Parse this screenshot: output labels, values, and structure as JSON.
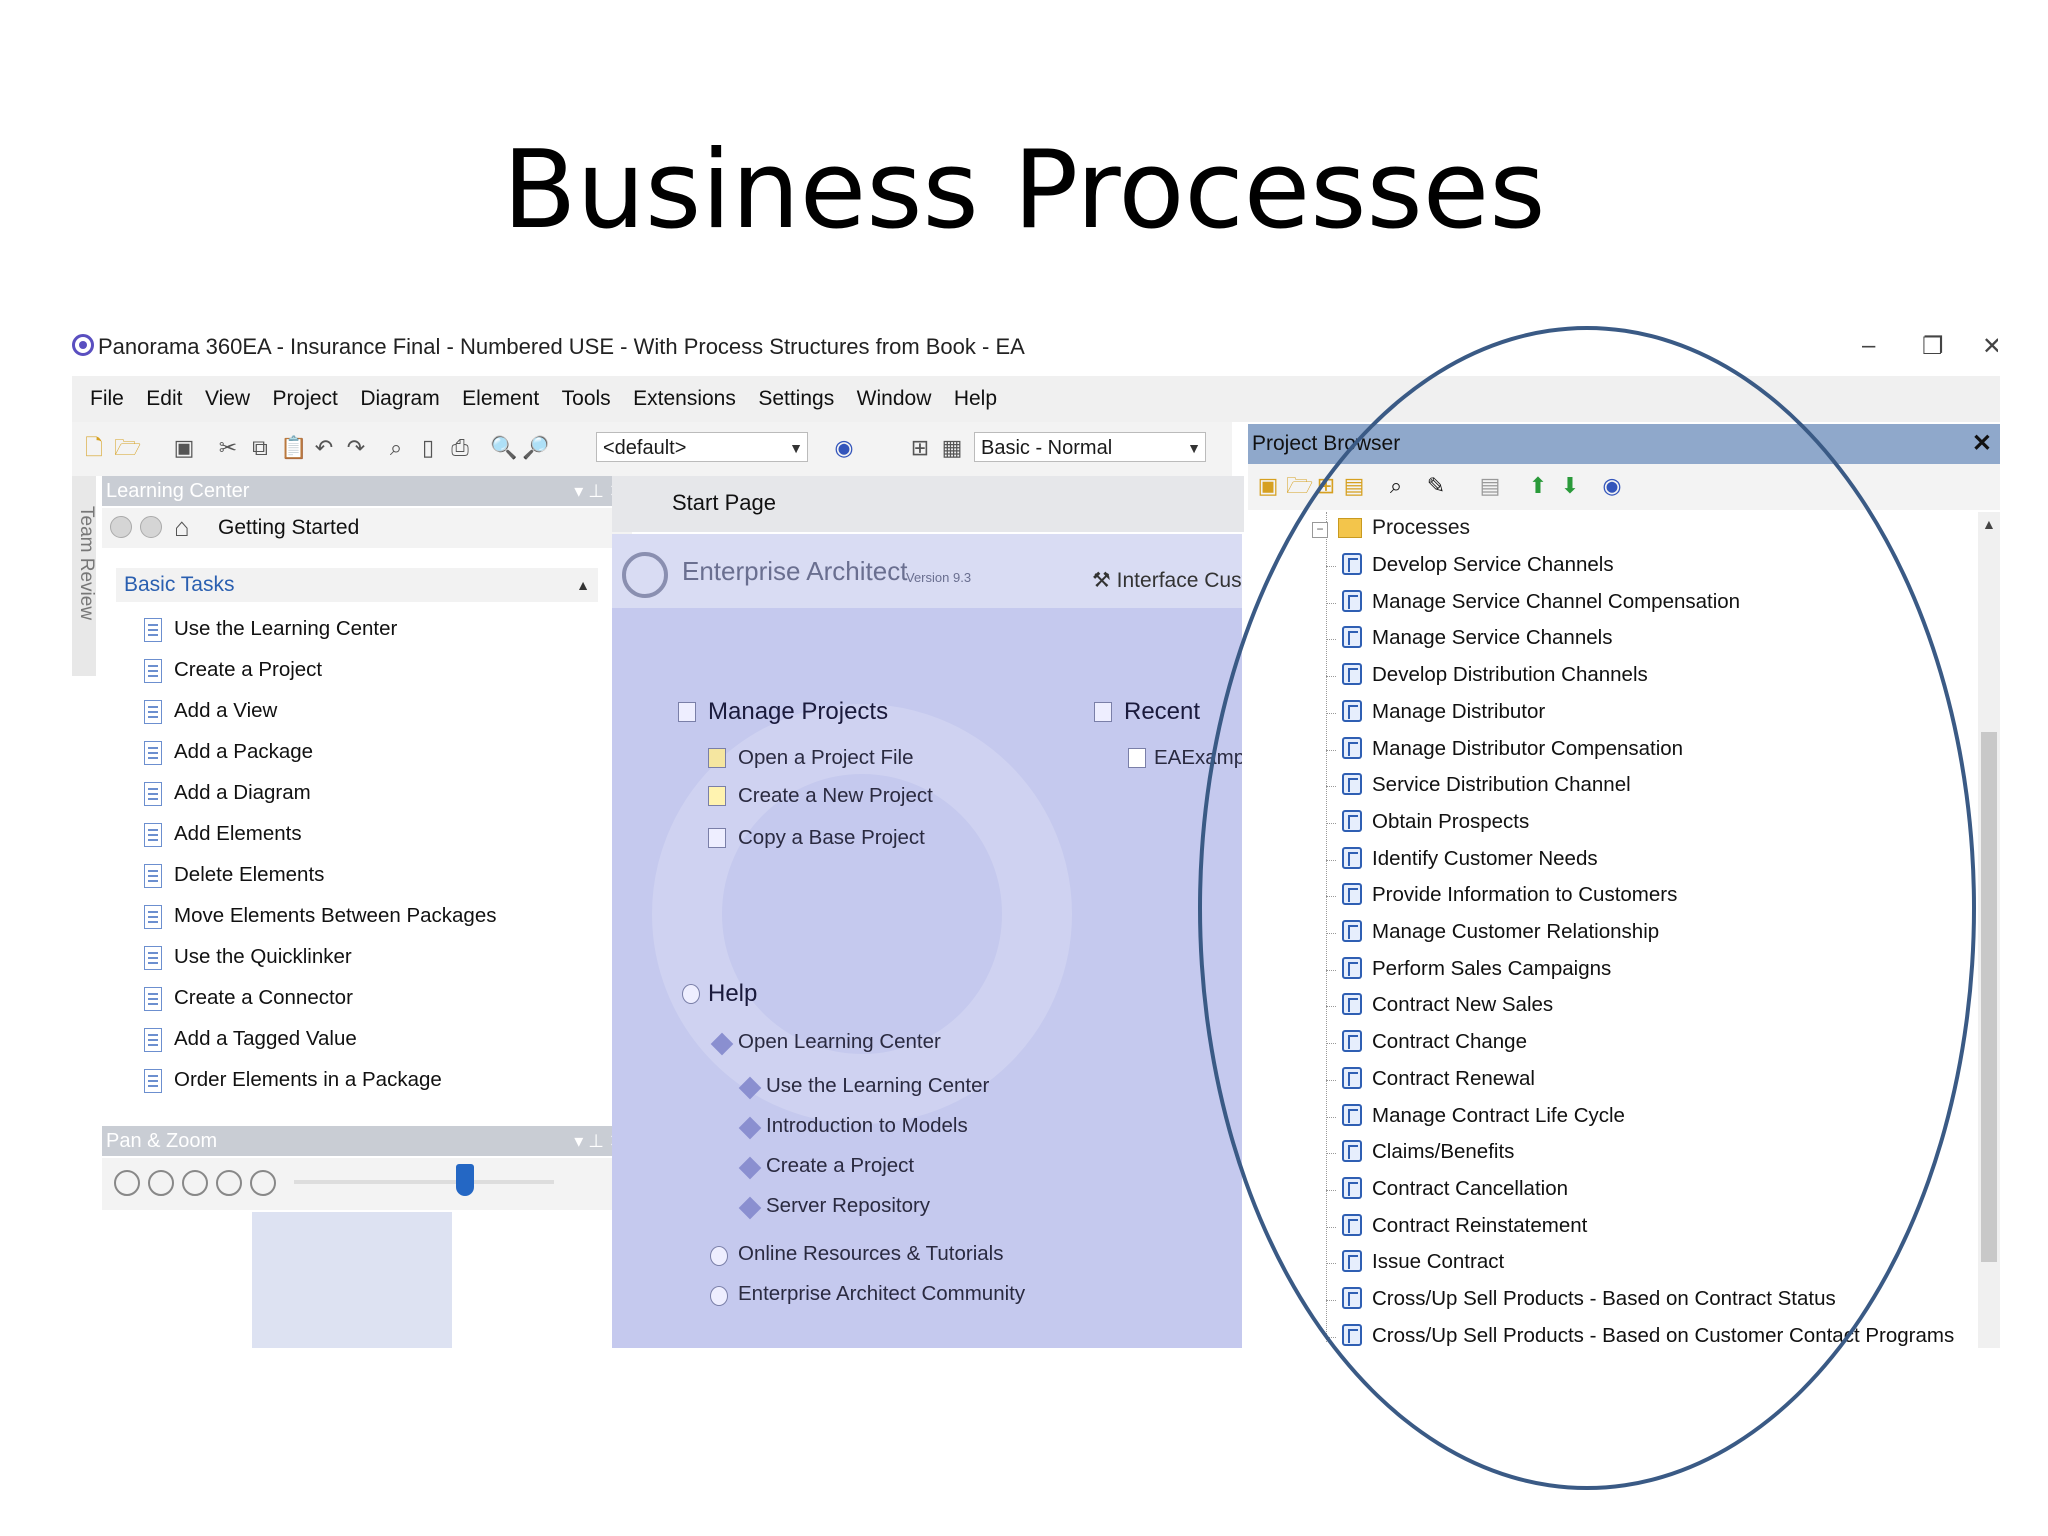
{
  "slide": {
    "title": "Business Processes"
  },
  "window": {
    "title": "Panorama 360EA - Insurance Final - Numbered USE - With Process Structures from Book - EA",
    "minimize": "–",
    "restore": "❐",
    "close": "✕"
  },
  "menu": [
    "File",
    "Edit",
    "View",
    "Project",
    "Diagram",
    "Element",
    "Tools",
    "Extensions",
    "Settings",
    "Window",
    "Help"
  ],
  "toolbar": {
    "perspective_combo": "<default>",
    "workspace_combo": "Basic - Normal"
  },
  "side_tab": {
    "label": "Team Review"
  },
  "learning_center": {
    "caption": "Learning Center",
    "nav_label": "Getting Started",
    "section_header": "Basic Tasks",
    "tasks": [
      "Use the Learning Center",
      "Create a Project",
      "Add a View",
      "Add a Package",
      "Add a Diagram",
      "Add Elements",
      "Delete Elements",
      "Move Elements Between Packages",
      "Use the Quicklinker",
      "Create a Connector",
      "Add a Tagged Value",
      "Order Elements in a Package"
    ]
  },
  "pan_zoom": {
    "caption": "Pan & Zoom",
    "zoom_level": 0.67
  },
  "start_page": {
    "tab": "Start Page",
    "product": "Enterprise Architect",
    "version": "Version 9.3",
    "interface_link": "Interface Custo",
    "manage_projects": {
      "heading": "Manage Projects",
      "links": [
        "Open a Project File",
        "Create a New Project",
        "Copy a Base Project"
      ]
    },
    "recent": {
      "heading": "Recent",
      "items": [
        "EAExample"
      ]
    },
    "help": {
      "heading": "Help",
      "open_learning_center": "Open Learning Center",
      "sub_links": [
        "Use the Learning Center",
        "Introduction to Models",
        "Create a Project",
        "Server Repository"
      ],
      "other_links": [
        "Online Resources & Tutorials",
        "Enterprise Architect Community"
      ]
    }
  },
  "project_browser": {
    "caption": "Project Browser",
    "root": "Processes",
    "items": [
      "Develop Service Channels",
      "Manage Service Channel Compensation",
      "Manage Service Channels",
      "Develop Distribution Channels",
      "Manage Distributor",
      "Manage Distributor Compensation",
      "Service Distribution Channel",
      "Obtain Prospects",
      "Identify Customer Needs",
      "Provide Information to Customers",
      "Manage Customer Relationship",
      "Perform Sales Campaigns",
      "Contract New Sales",
      "Contract Change",
      "Contract Renewal",
      "Manage Contract Life Cycle",
      "Claims/Benefits",
      "Contract Cancellation",
      "Contract Reinstatement",
      "Issue Contract",
      "Cross/Up Sell Products - Based on Contract Status",
      "Cross/Up Sell Products - Based on Customer Contact Programs"
    ]
  },
  "colors": {
    "panel_caption": "#c9cdd4",
    "project_browser_caption": "#8fa8cb",
    "start_page_bg": "#c5c9ee",
    "highlight_ellipse": "#3a5a85",
    "process_icon": "#2f5fb3",
    "basic_tasks_header": "#2a5fb0"
  }
}
